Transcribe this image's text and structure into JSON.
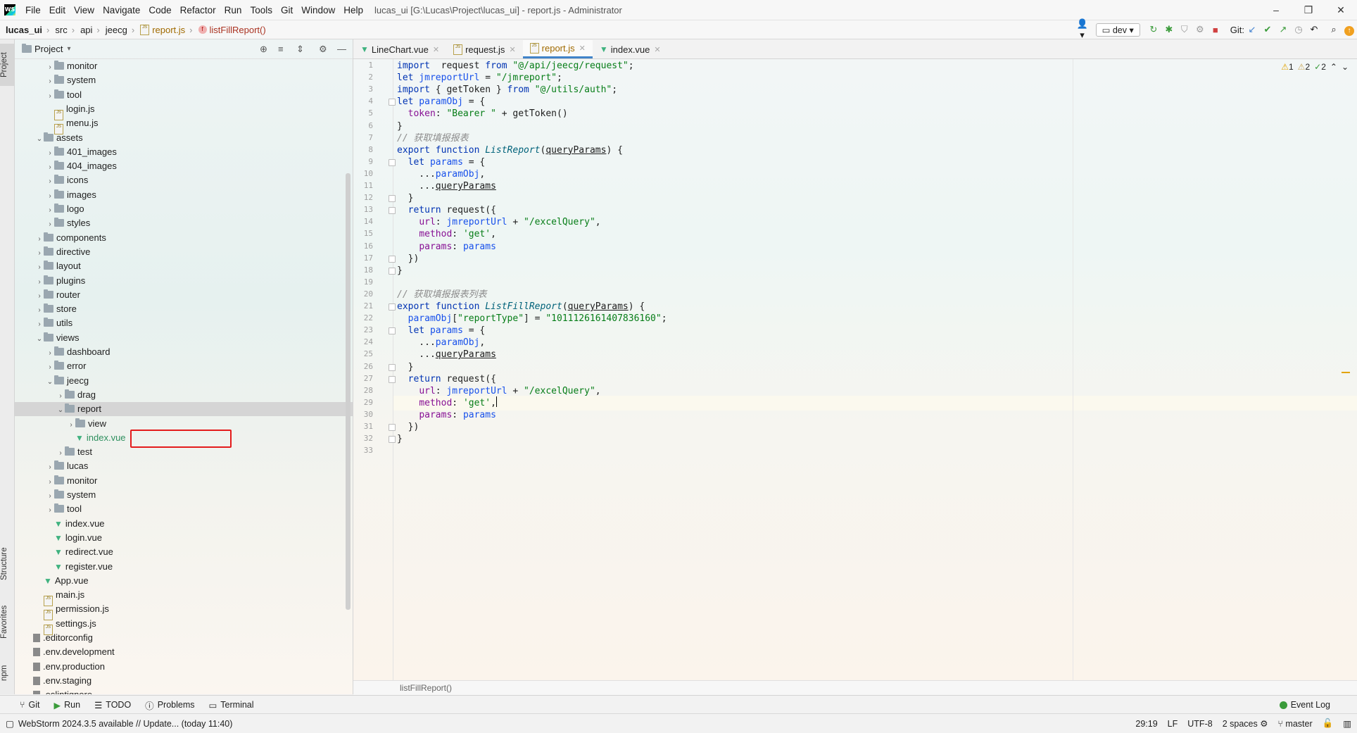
{
  "window": {
    "logo": "WS",
    "menu": [
      "File",
      "Edit",
      "View",
      "Navigate",
      "Code",
      "Refactor",
      "Run",
      "Tools",
      "Git",
      "Window",
      "Help"
    ],
    "title": "lucas_ui [G:\\Lucas\\Project\\lucas_ui] - report.js - Administrator",
    "controls": [
      "–",
      "❐",
      "✕"
    ]
  },
  "navbar": {
    "crumbs": [
      "lucas_ui",
      "src",
      "api",
      "jeecg",
      "report.js",
      "listFillReport()"
    ],
    "branch": "dev",
    "git_label": "Git:"
  },
  "left_stripe": {
    "project": "Project",
    "structure": "Structure",
    "favorites": "Favorites",
    "npm": "npm"
  },
  "project": {
    "header": "Project",
    "tree": [
      {
        "label": "monitor",
        "type": "folder",
        "depth": 3,
        "arrow": "›"
      },
      {
        "label": "system",
        "type": "folder",
        "depth": 3,
        "arrow": "›"
      },
      {
        "label": "tool",
        "type": "folder",
        "depth": 3,
        "arrow": "›"
      },
      {
        "label": "login.js",
        "type": "js",
        "depth": 3,
        "arrow": ""
      },
      {
        "label": "menu.js",
        "type": "js",
        "depth": 3,
        "arrow": ""
      },
      {
        "label": "assets",
        "type": "folder",
        "depth": 2,
        "arrow": "⌄"
      },
      {
        "label": "401_images",
        "type": "folder",
        "depth": 3,
        "arrow": "›"
      },
      {
        "label": "404_images",
        "type": "folder",
        "depth": 3,
        "arrow": "›"
      },
      {
        "label": "icons",
        "type": "folder",
        "depth": 3,
        "arrow": "›"
      },
      {
        "label": "images",
        "type": "folder",
        "depth": 3,
        "arrow": "›"
      },
      {
        "label": "logo",
        "type": "folder",
        "depth": 3,
        "arrow": "›"
      },
      {
        "label": "styles",
        "type": "folder",
        "depth": 3,
        "arrow": "›"
      },
      {
        "label": "components",
        "type": "folder",
        "depth": 2,
        "arrow": "›"
      },
      {
        "label": "directive",
        "type": "folder",
        "depth": 2,
        "arrow": "›"
      },
      {
        "label": "layout",
        "type": "folder",
        "depth": 2,
        "arrow": "›"
      },
      {
        "label": "plugins",
        "type": "folder",
        "depth": 2,
        "arrow": "›"
      },
      {
        "label": "router",
        "type": "folder",
        "depth": 2,
        "arrow": "›"
      },
      {
        "label": "store",
        "type": "folder",
        "depth": 2,
        "arrow": "›"
      },
      {
        "label": "utils",
        "type": "folder",
        "depth": 2,
        "arrow": "›"
      },
      {
        "label": "views",
        "type": "folder",
        "depth": 2,
        "arrow": "⌄"
      },
      {
        "label": "dashboard",
        "type": "folder",
        "depth": 3,
        "arrow": "›"
      },
      {
        "label": "error",
        "type": "folder",
        "depth": 3,
        "arrow": "›"
      },
      {
        "label": "jeecg",
        "type": "folder",
        "depth": 3,
        "arrow": "⌄"
      },
      {
        "label": "drag",
        "type": "folder",
        "depth": 4,
        "arrow": "›"
      },
      {
        "label": "report",
        "type": "folder",
        "depth": 4,
        "arrow": "⌄",
        "selected": true
      },
      {
        "label": "view",
        "type": "folder",
        "depth": 5,
        "arrow": "›"
      },
      {
        "label": "index.vue",
        "type": "vue",
        "depth": 5,
        "arrow": "",
        "highlight": true
      },
      {
        "label": "test",
        "type": "folder",
        "depth": 4,
        "arrow": "›"
      },
      {
        "label": "lucas",
        "type": "folder",
        "depth": 3,
        "arrow": "›"
      },
      {
        "label": "monitor",
        "type": "folder",
        "depth": 3,
        "arrow": "›"
      },
      {
        "label": "system",
        "type": "folder",
        "depth": 3,
        "arrow": "›"
      },
      {
        "label": "tool",
        "type": "folder",
        "depth": 3,
        "arrow": "›"
      },
      {
        "label": "index.vue",
        "type": "vue",
        "depth": 3,
        "arrow": ""
      },
      {
        "label": "login.vue",
        "type": "vue",
        "depth": 3,
        "arrow": ""
      },
      {
        "label": "redirect.vue",
        "type": "vue",
        "depth": 3,
        "arrow": ""
      },
      {
        "label": "register.vue",
        "type": "vue",
        "depth": 3,
        "arrow": ""
      },
      {
        "label": "App.vue",
        "type": "vue",
        "depth": 2,
        "arrow": ""
      },
      {
        "label": "main.js",
        "type": "js",
        "depth": 2,
        "arrow": ""
      },
      {
        "label": "permission.js",
        "type": "js",
        "depth": 2,
        "arrow": ""
      },
      {
        "label": "settings.js",
        "type": "js",
        "depth": 2,
        "arrow": ""
      },
      {
        "label": ".editorconfig",
        "type": "cfg",
        "depth": 1,
        "arrow": ""
      },
      {
        "label": ".env.development",
        "type": "cfg",
        "depth": 1,
        "arrow": ""
      },
      {
        "label": ".env.production",
        "type": "cfg",
        "depth": 1,
        "arrow": ""
      },
      {
        "label": ".env.staging",
        "type": "cfg",
        "depth": 1,
        "arrow": ""
      },
      {
        "label": ".eslintignore",
        "type": "cfg",
        "depth": 1,
        "arrow": ""
      }
    ]
  },
  "editor": {
    "tabs": [
      {
        "label": "LineChart.vue",
        "type": "vue",
        "active": false
      },
      {
        "label": "request.js",
        "type": "js",
        "active": false
      },
      {
        "label": "report.js",
        "type": "js",
        "active": true
      },
      {
        "label": "index.vue",
        "type": "vue",
        "active": false
      }
    ],
    "inspections": {
      "warnings": "1",
      "weak_warnings": "2",
      "typos": "2"
    },
    "lines": [
      [
        [
          "kw",
          "import"
        ],
        [
          "",
          "  request "
        ],
        [
          "kw",
          "from"
        ],
        [
          "str",
          " \"@/api/jeecg/request\""
        ],
        [
          "",
          ";"
        ]
      ],
      [
        [
          "kw",
          "let"
        ],
        [
          "var",
          " jmreportUrl"
        ],
        [
          "",
          " = "
        ],
        [
          "str",
          "\"/jmreport\""
        ],
        [
          "",
          ";"
        ]
      ],
      [
        [
          "kw",
          "import"
        ],
        [
          "",
          " { getToken } "
        ],
        [
          "kw",
          "from"
        ],
        [
          "str",
          " \"@/utils/auth\""
        ],
        [
          "",
          ";"
        ]
      ],
      [
        [
          "kw",
          "let"
        ],
        [
          "var",
          " paramObj"
        ],
        [
          "",
          " = {"
        ]
      ],
      [
        [
          "",
          "  "
        ],
        [
          "prop",
          "token"
        ],
        [
          "",
          ": "
        ],
        [
          "str",
          "\"Bearer \""
        ],
        [
          "",
          " + getToken()"
        ]
      ],
      [
        [
          "",
          "}"
        ]
      ],
      [
        [
          "cmt",
          "// 获取填报报表"
        ]
      ],
      [
        [
          "kw",
          "export function "
        ],
        [
          "fn",
          "ListReport"
        ],
        [
          "",
          "("
        ],
        [
          "ul",
          "queryParams"
        ],
        [
          "",
          ") {"
        ]
      ],
      [
        [
          "",
          "  "
        ],
        [
          "kw",
          "let"
        ],
        [
          "var",
          " params"
        ],
        [
          "",
          " = {"
        ]
      ],
      [
        [
          "",
          "    ..."
        ],
        [
          "var",
          "paramObj"
        ],
        [
          "",
          ","
        ]
      ],
      [
        [
          "",
          "    ..."
        ],
        [
          "ul",
          "queryParams"
        ]
      ],
      [
        [
          "",
          "  }"
        ]
      ],
      [
        [
          "",
          "  "
        ],
        [
          "kw",
          "return"
        ],
        [
          "",
          " request({"
        ]
      ],
      [
        [
          "",
          "    "
        ],
        [
          "prop",
          "url"
        ],
        [
          "",
          ": "
        ],
        [
          "var",
          "jmreportUrl"
        ],
        [
          "",
          " + "
        ],
        [
          "str",
          "\"/excelQuery\""
        ],
        [
          "",
          ","
        ]
      ],
      [
        [
          "",
          "    "
        ],
        [
          "prop",
          "method"
        ],
        [
          "",
          ": "
        ],
        [
          "str",
          "'get'"
        ],
        [
          "",
          ","
        ]
      ],
      [
        [
          "",
          "    "
        ],
        [
          "prop",
          "params"
        ],
        [
          "",
          ": "
        ],
        [
          "var",
          "params"
        ]
      ],
      [
        [
          "",
          "  })"
        ]
      ],
      [
        [
          "",
          "}"
        ]
      ],
      [
        [
          "",
          ""
        ]
      ],
      [
        [
          "cmt",
          "// 获取填报报表列表"
        ]
      ],
      [
        [
          "kw",
          "export function "
        ],
        [
          "fn",
          "ListFillReport"
        ],
        [
          "",
          "("
        ],
        [
          "ul",
          "queryParams"
        ],
        [
          "",
          ") {"
        ]
      ],
      [
        [
          "",
          "  "
        ],
        [
          "var",
          "paramObj"
        ],
        [
          "",
          "["
        ],
        [
          "str",
          "\"reportType\""
        ],
        [
          "",
          "] = "
        ],
        [
          "str",
          "\"1011126161407836160\""
        ],
        [
          "",
          ";"
        ]
      ],
      [
        [
          "",
          "  "
        ],
        [
          "kw",
          "let"
        ],
        [
          "var",
          " params"
        ],
        [
          "",
          " = {"
        ]
      ],
      [
        [
          "",
          "    ..."
        ],
        [
          "var",
          "paramObj"
        ],
        [
          "",
          ","
        ]
      ],
      [
        [
          "",
          "    ..."
        ],
        [
          "ul",
          "queryParams"
        ]
      ],
      [
        [
          "",
          "  }"
        ]
      ],
      [
        [
          "",
          "  "
        ],
        [
          "kw",
          "return"
        ],
        [
          "",
          " request({"
        ]
      ],
      [
        [
          "",
          "    "
        ],
        [
          "prop",
          "url"
        ],
        [
          "",
          ": "
        ],
        [
          "var",
          "jmreportUrl"
        ],
        [
          "",
          " + "
        ],
        [
          "str",
          "\"/excelQuery\""
        ],
        [
          "",
          ","
        ]
      ],
      [
        [
          "",
          "    "
        ],
        [
          "prop",
          "method"
        ],
        [
          "",
          ": "
        ],
        [
          "str",
          "'get'"
        ],
        [
          "",
          ","
        ],
        [
          "caret",
          ""
        ]
      ],
      [
        [
          "",
          "    "
        ],
        [
          "prop",
          "params"
        ],
        [
          "",
          ": "
        ],
        [
          "var",
          "params"
        ]
      ],
      [
        [
          "",
          "  })"
        ]
      ],
      [
        [
          "",
          "}"
        ]
      ],
      [
        [
          "",
          ""
        ]
      ]
    ],
    "current_line": 29,
    "breadcrumb": "listFillReport()"
  },
  "toolwindows": [
    "Git",
    "Run",
    "TODO",
    "Problems",
    "Terminal"
  ],
  "event_log": "Event Log",
  "status": {
    "message": "WebStorm 2024.3.5 available // Update... (today 11:40)",
    "position": "29:19",
    "line_sep": "LF",
    "encoding": "UTF-8",
    "indent": "2 spaces",
    "branch": "master"
  },
  "colors": {
    "accent": "#4083c9",
    "vue": "#3fb27f",
    "red_box": "#e41b1b",
    "warning": "#e2a300"
  }
}
